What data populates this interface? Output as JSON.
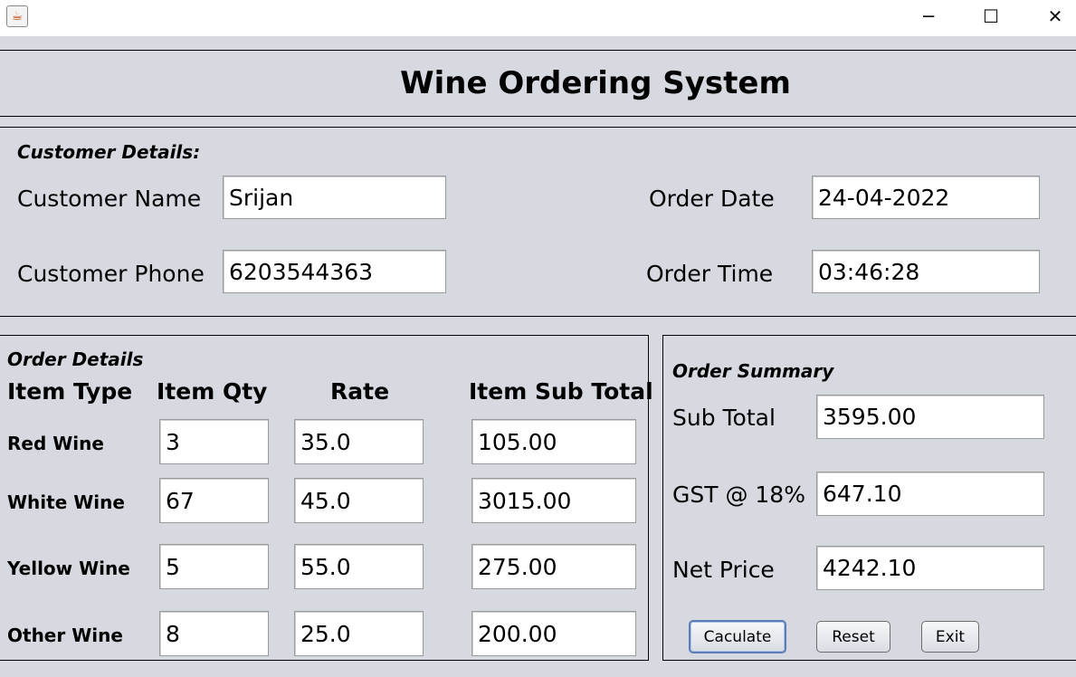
{
  "window": {
    "app_icon": "java-cup-icon",
    "controls": {
      "minimize": "─",
      "maximize": "☐",
      "close": "✕"
    }
  },
  "title": "Wine Ordering System",
  "customer": {
    "header": "Customer Details:",
    "name_label": "Customer Name",
    "name_value": "Srijan",
    "phone_label": "Customer Phone",
    "phone_value": "6203544363",
    "date_label": "Order Date",
    "date_value": "24-04-2022",
    "time_label": "Order Time",
    "time_value": "03:46:28"
  },
  "order": {
    "header": "Order Details",
    "columns": [
      "Item Type",
      "Item Qty",
      "Rate",
      "Item Sub Total"
    ],
    "rows": [
      {
        "type": "Red Wine",
        "qty": "3",
        "rate": "35.0",
        "subtotal": "105.00"
      },
      {
        "type": "White Wine",
        "qty": "67",
        "rate": "45.0",
        "subtotal": "3015.00"
      },
      {
        "type": "Yellow Wine",
        "qty": "5",
        "rate": "55.0",
        "subtotal": "275.00"
      },
      {
        "type": "Other Wine",
        "qty": "8",
        "rate": "25.0",
        "subtotal": "200.00"
      }
    ]
  },
  "summary": {
    "header": "Order Summary",
    "subtotal_label": "Sub Total",
    "subtotal_value": "3595.00",
    "gst_label": "GST @ 18%",
    "gst_value": "647.10",
    "net_label": "Net Price",
    "net_value": "4242.10"
  },
  "buttons": {
    "calculate": "Caculate",
    "reset": "Reset",
    "exit": "Exit"
  }
}
